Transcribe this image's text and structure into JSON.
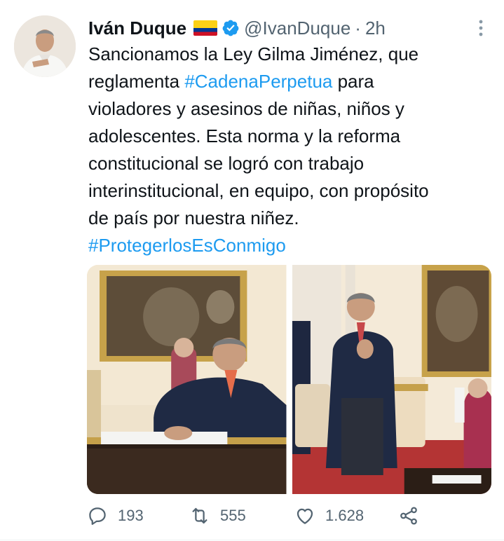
{
  "author": {
    "name": "Iván Duque",
    "handle": "@IvanDuque",
    "separator": "·",
    "time": "2h"
  },
  "tweet": {
    "lines": [
      [
        "Sancionamos la Ley Gilma Jiménez, que"
      ],
      [
        "reglamenta ",
        "#CadenaPerpetua",
        " para"
      ],
      [
        "violadores y asesinos de niñas, niños y"
      ],
      [
        "adolescentes. Esta norma y la reforma"
      ],
      [
        "constitucional se logró con trabajo"
      ],
      [
        "interinstitucional, en equipo, con propósito"
      ],
      [
        "de país por nuestra niñez."
      ],
      [
        "#ProtegerlosEsConmigo"
      ]
    ]
  },
  "stats": {
    "replies": "193",
    "retweets": "555",
    "likes": "1.628"
  },
  "colors": {
    "link": "#1d9bf0",
    "muted": "#536471",
    "verified": "#1d9bf0",
    "flag": [
      "#fcd116",
      "#003893",
      "#ce1126"
    ]
  },
  "icons": [
    "verified-badge-icon",
    "more-options-icon",
    "reply-icon",
    "retweet-icon",
    "like-icon",
    "share-icon"
  ]
}
